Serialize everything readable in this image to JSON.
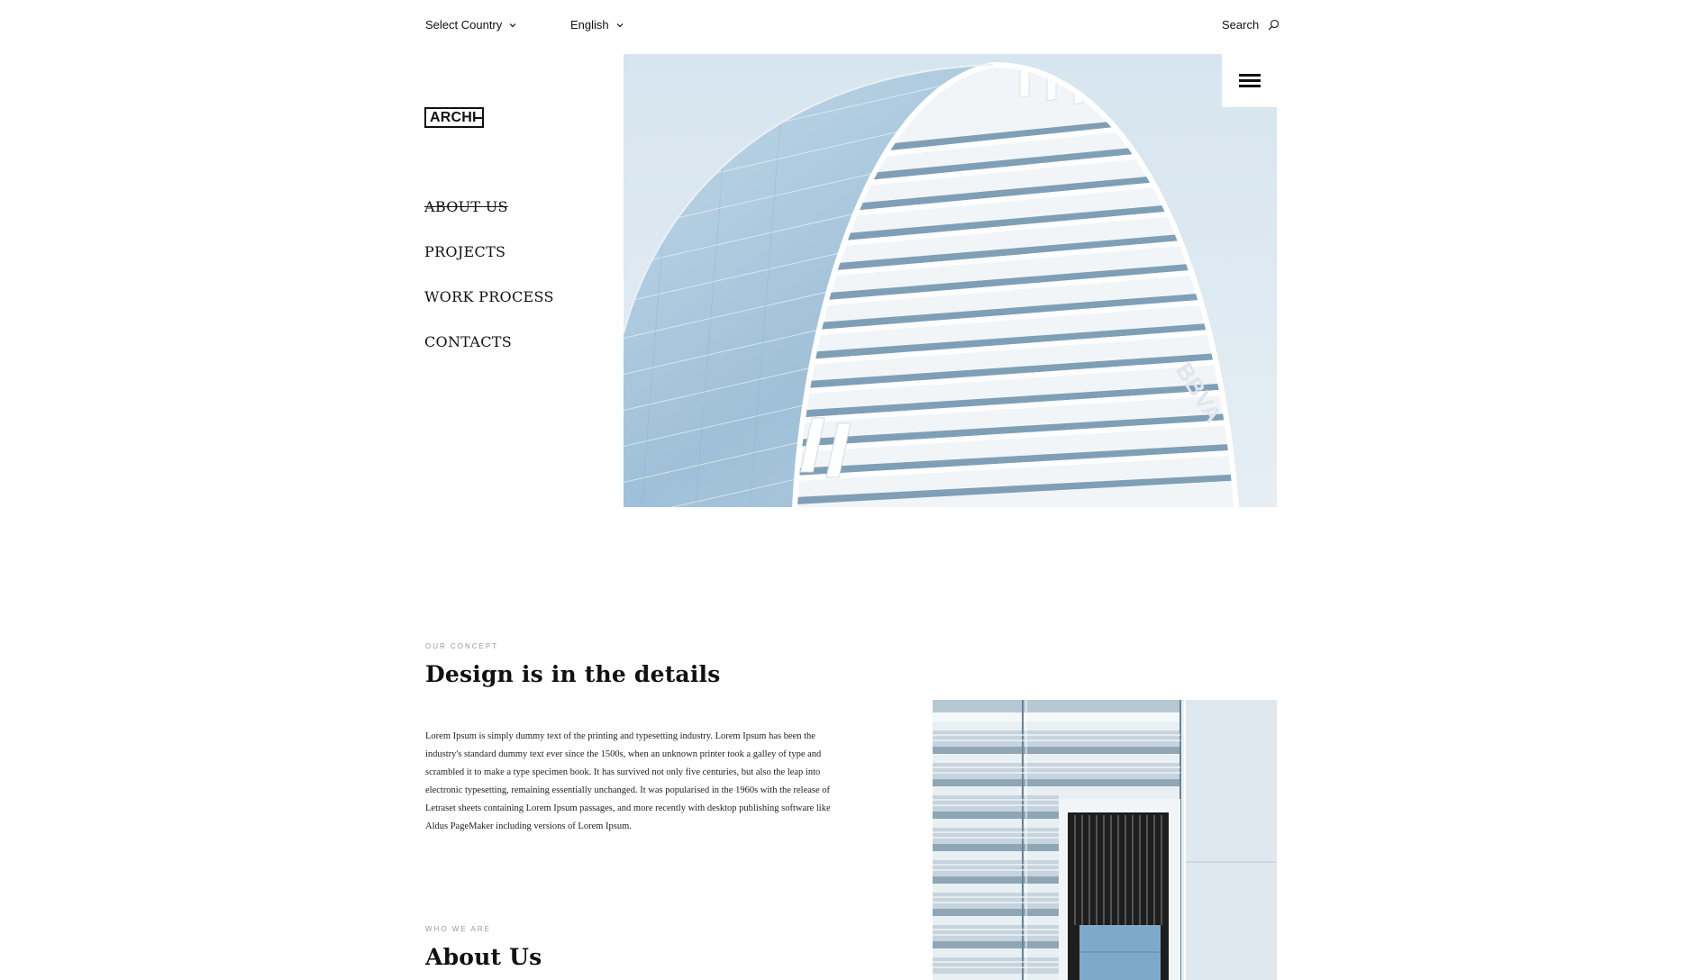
{
  "topbar": {
    "country_label": "Select Country",
    "language_label": "English",
    "search_label": "Search"
  },
  "logo": {
    "text": "ARCHI"
  },
  "nav": {
    "items": [
      {
        "label": "ABOUT US",
        "active": true
      },
      {
        "label": "PROJECTS",
        "active": false
      },
      {
        "label": "WORK PROCESS",
        "active": false
      },
      {
        "label": "CONTACTS",
        "active": false
      }
    ]
  },
  "hero": {
    "image_alt": "Curved white architectural facade against a pale blue sky",
    "building_sign": "BBVA"
  },
  "concept": {
    "eyebrow": "OUR CONCEPT",
    "title": "Design is in the details",
    "body": "Lorem Ipsum is simply dummy text of the printing and typesetting industry. Lorem Ipsum has been the industry's standard dummy text ever since the 1500s, when an unknown printer took a galley of type and scrambled it to make a type specimen book. It has survived not only five centuries, but also the leap into electronic typesetting, remaining essentially unchanged. It was popularised in the 1960s with the release of Letraset sheets containing Lorem Ipsum passages, and more recently with desktop publishing software like Aldus PageMaker including versions of Lorem Ipsum."
  },
  "about": {
    "eyebrow": "WHO WE ARE",
    "title": "About Us"
  },
  "icons": {
    "country_chevron": "chevron-down-icon",
    "language_chevron": "chevron-down-icon",
    "search": "search-icon",
    "menu": "hamburger-menu-icon"
  },
  "colors": {
    "text": "#111111",
    "muted": "#9a9a9a",
    "sky": "#dbe7f0",
    "background": "#ffffff"
  }
}
